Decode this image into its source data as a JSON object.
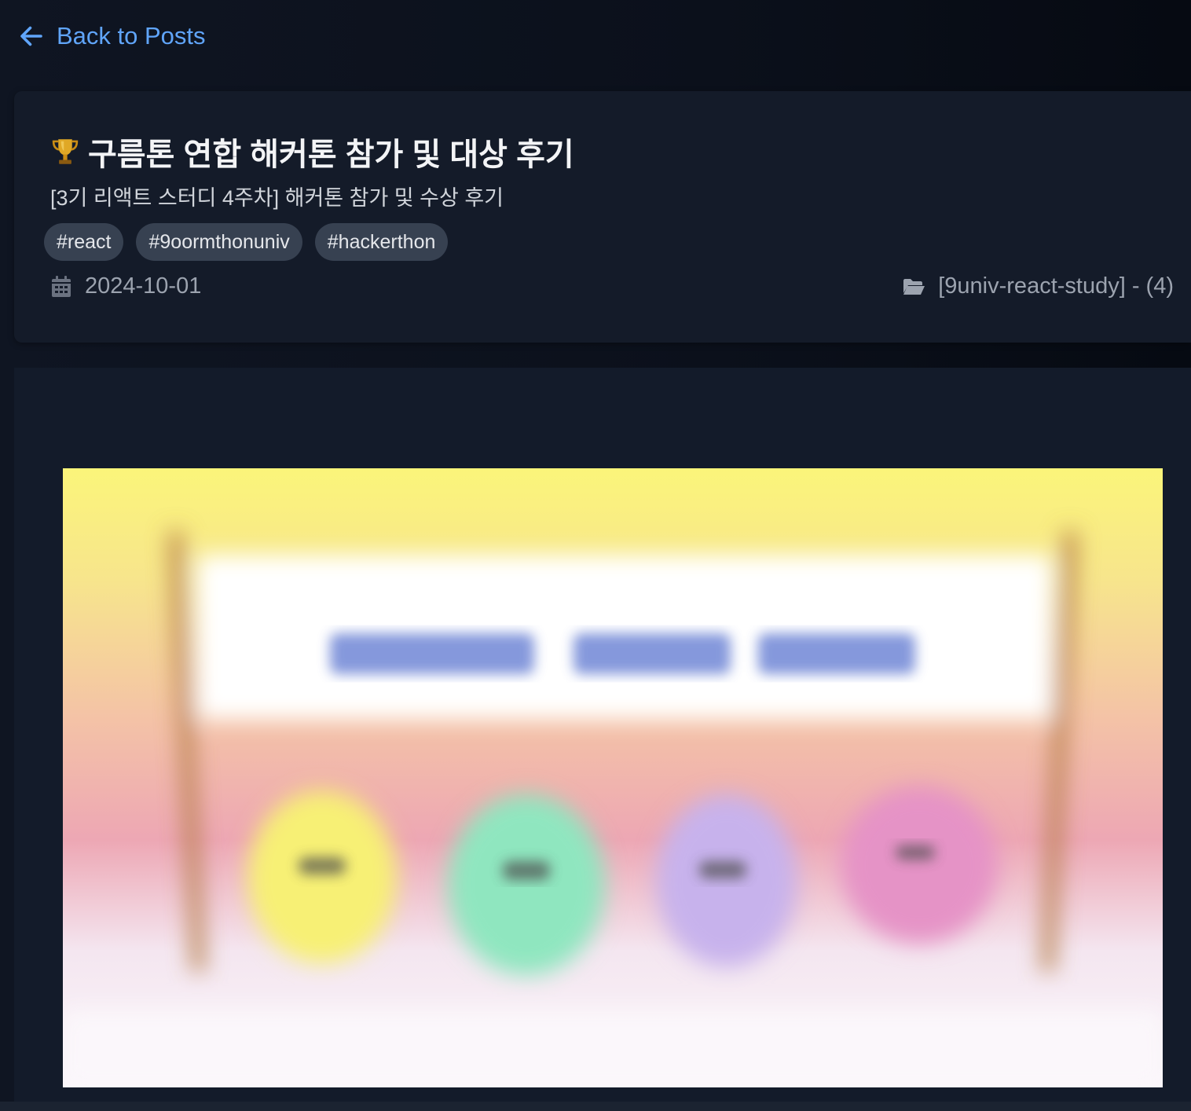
{
  "nav": {
    "back_label": "Back to Posts",
    "back_icon": "arrow-left-icon"
  },
  "post": {
    "title_icon": "trophy-icon",
    "title": "구름톤 연합 해커톤 참가 및 대상 후기",
    "subtitle": "[3기 리액트 스터디 4주차] 해커톤 참가 및 수상 후기",
    "tags": [
      "#react",
      "#9oormthonuniv",
      "#hackerthon"
    ],
    "date_icon": "calendar-icon",
    "date": "2024-10-01",
    "category_icon": "folder-open-icon",
    "category": "[9univ-react-study] - (4)"
  },
  "hero_image": {
    "subject": "blurred banner illustration with four mascot characters (yellow, green, purple, pink) under a white banner"
  },
  "colors": {
    "accent": "#60a5fa",
    "background": "#0b101b",
    "card": "#141b29",
    "tag_bg": "#374151",
    "muted_text": "#9ca3af"
  }
}
